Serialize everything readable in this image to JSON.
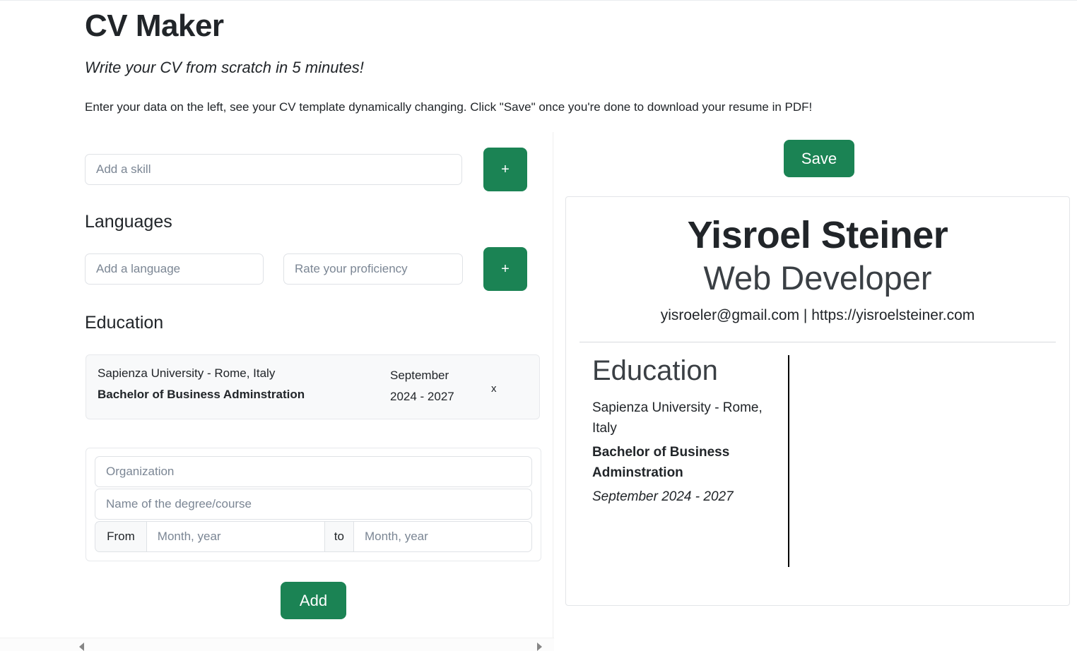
{
  "header": {
    "title": "CV Maker",
    "tagline": "Write your CV from scratch in 5 minutes!",
    "instructions": "Enter your data on the left, see your CV template dynamically changing. Click \"Save\" once you're done to download your resume in PDF!"
  },
  "form": {
    "skill": {
      "placeholder": "Add a skill",
      "add_label": "+"
    },
    "languages": {
      "heading": "Languages",
      "language_placeholder": "Add a language",
      "proficiency_placeholder": "Rate your proficiency",
      "add_label": "+"
    },
    "education": {
      "heading": "Education",
      "entries": [
        {
          "organization": "Sapienza University - Rome, Italy",
          "degree": "Bachelor of Business Adminstration",
          "dates": "September 2024 - 2027",
          "remove_label": "x"
        }
      ],
      "new_entry": {
        "organization_placeholder": "Organization",
        "degree_placeholder": "Name of the degree/course",
        "from_label": "From",
        "from_placeholder": "Month, year",
        "to_label": "to",
        "to_placeholder": "Month, year"
      },
      "add_label": "Add"
    }
  },
  "preview": {
    "save_label": "Save",
    "cv": {
      "name": "Yisroel Steiner",
      "role": "Web Developer",
      "contact": "yisroeler@gmail.com | https://yisroelsteiner.com",
      "education_title": "Education",
      "education": [
        {
          "organization": "Sapienza University - Rome, Italy",
          "degree": "Bachelor of Business Adminstration",
          "dates": "September 2024 - 2027"
        }
      ]
    }
  },
  "colors": {
    "accent_green": "#1b8354",
    "text": "#212529",
    "placeholder": "#7b8694",
    "card_bg": "#f8f9fa",
    "border": "#dfe2e6"
  }
}
